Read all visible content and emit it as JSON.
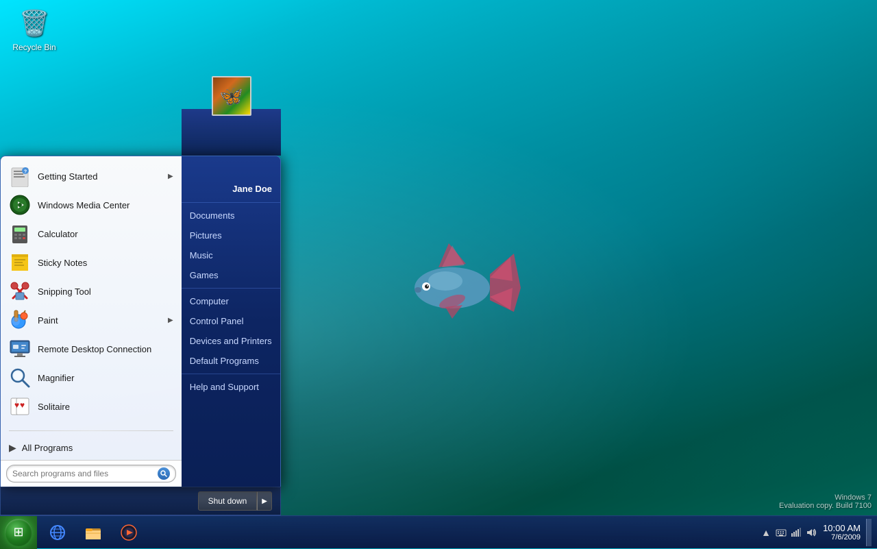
{
  "desktop": {
    "background_desc": "Windows 7 teal aqua desktop background with fish",
    "recycle_bin": {
      "label": "Recycle Bin",
      "icon": "🗑"
    }
  },
  "start_menu": {
    "visible": true,
    "user": {
      "name": "Jane Doe",
      "avatar_desc": "butterfly photo"
    },
    "left_items": [
      {
        "id": "getting-started",
        "label": "Getting Started",
        "has_arrow": true,
        "icon": "📄"
      },
      {
        "id": "windows-media-center",
        "label": "Windows Media Center",
        "has_arrow": false,
        "icon": "▶"
      },
      {
        "id": "calculator",
        "label": "Calculator",
        "has_arrow": false,
        "icon": "🧮"
      },
      {
        "id": "sticky-notes",
        "label": "Sticky Notes",
        "has_arrow": false,
        "icon": "📝"
      },
      {
        "id": "snipping-tool",
        "label": "Snipping Tool",
        "has_arrow": false,
        "icon": "✂"
      },
      {
        "id": "paint",
        "label": "Paint",
        "has_arrow": true,
        "icon": "🎨"
      },
      {
        "id": "remote-desktop",
        "label": "Remote Desktop Connection",
        "has_arrow": false,
        "icon": "🖥"
      },
      {
        "id": "magnifier",
        "label": "Magnifier",
        "has_arrow": false,
        "icon": "🔍"
      },
      {
        "id": "solitaire",
        "label": "Solitaire",
        "has_arrow": false,
        "icon": "🃏"
      }
    ],
    "all_programs_label": "All Programs",
    "search_placeholder": "Search programs and files",
    "right_items": [
      {
        "id": "documents",
        "label": "Documents"
      },
      {
        "id": "pictures",
        "label": "Pictures"
      },
      {
        "id": "music",
        "label": "Music"
      },
      {
        "id": "games",
        "label": "Games"
      },
      {
        "id": "computer",
        "label": "Computer"
      },
      {
        "id": "control-panel",
        "label": "Control Panel"
      },
      {
        "id": "devices-printers",
        "label": "Devices and Printers"
      },
      {
        "id": "default-programs",
        "label": "Default Programs"
      },
      {
        "id": "help-support",
        "label": "Help and Support"
      }
    ],
    "shutdown_label": "Shut down"
  },
  "taskbar": {
    "items": [
      {
        "id": "ie",
        "icon": "🌐",
        "label": "Internet Explorer"
      },
      {
        "id": "explorer",
        "icon": "📁",
        "label": "Windows Explorer"
      },
      {
        "id": "media-player",
        "icon": "🎵",
        "label": "Windows Media Player"
      }
    ],
    "tray": {
      "time": "10:00 AM",
      "date": "7/6/2009",
      "icons": [
        "▲",
        "⌨",
        "📶",
        "🔊"
      ]
    }
  },
  "watermark": {
    "line1": "Windows 7",
    "line2": "Evaluation copy. Build 7100"
  }
}
